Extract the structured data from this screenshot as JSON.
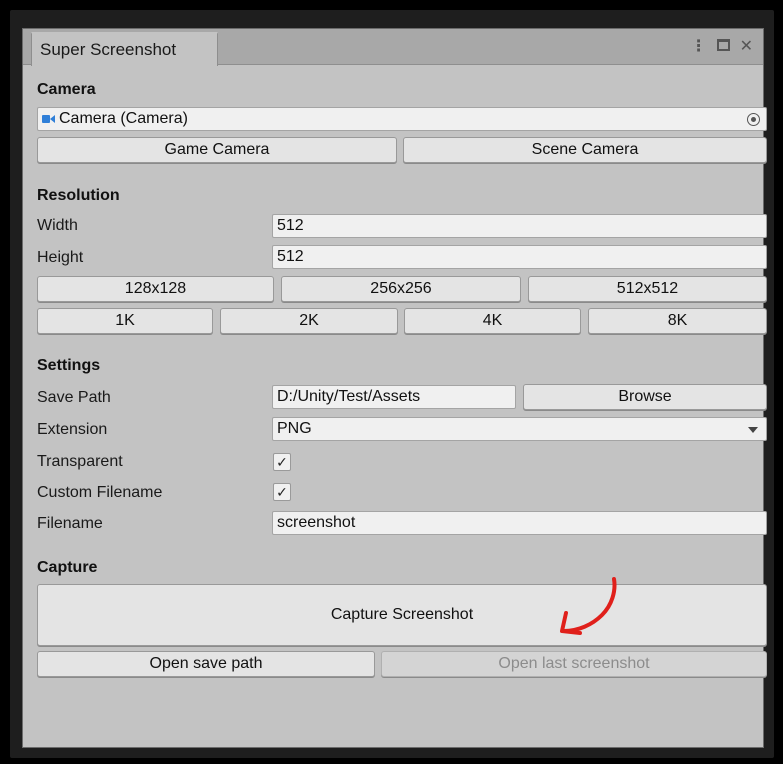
{
  "window": {
    "tab_title": "Super Screenshot",
    "icons": [
      "kebab-menu-icon",
      "maximize-icon",
      "close-icon"
    ],
    "close_glyph": "✕",
    "kebab_glyph": "⋮"
  },
  "camera": {
    "header": "Camera",
    "object_field_value": "Camera (Camera)",
    "game_camera_label": "Game Camera",
    "scene_camera_label": "Scene Camera"
  },
  "resolution": {
    "header": "Resolution",
    "width_label": "Width",
    "width_value": "512",
    "height_label": "Height",
    "height_value": "512",
    "preset_row1": [
      "128x128",
      "256x256",
      "512x512"
    ],
    "preset_row2": [
      "1K",
      "2K",
      "4K",
      "8K"
    ]
  },
  "settings": {
    "header": "Settings",
    "save_path_label": "Save Path",
    "save_path_value": "D:/Unity/Test/Assets",
    "browse_label": "Browse",
    "extension_label": "Extension",
    "extension_value": "PNG",
    "transparent_label": "Transparent",
    "transparent_checked": true,
    "custom_filename_label": "Custom Filename",
    "custom_filename_checked": true,
    "filename_label": "Filename",
    "filename_value": "screenshot",
    "check_glyph": "✓"
  },
  "capture": {
    "header": "Capture",
    "capture_button_label": "Capture Screenshot",
    "open_save_path_label": "Open save path",
    "open_last_screenshot_label": "Open last screenshot",
    "open_last_screenshot_enabled": false
  },
  "colors": {
    "panel_bg": "#c3c3c3",
    "field_bg": "#f0f0f0",
    "button_bg": "#e4e4e4",
    "annotation_arrow": "#e0201b",
    "camera_icon": "#2f7fd8"
  }
}
